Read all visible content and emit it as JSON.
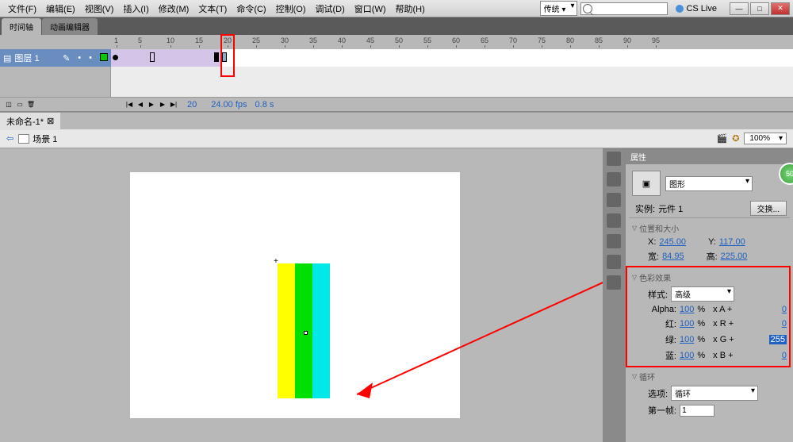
{
  "menu": {
    "file": "文件(F)",
    "edit": "编辑(E)",
    "view": "视图(V)",
    "insert": "插入(I)",
    "modify": "修改(M)",
    "text": "文本(T)",
    "commands": "命令(C)",
    "control": "控制(O)",
    "debug": "调试(D)",
    "window": "窗口(W)",
    "help": "帮助(H)"
  },
  "top_right": {
    "workspace": "传统 ▾",
    "cslive": "CS Live"
  },
  "tabs": {
    "timeline": "时间轴",
    "motion": "动画编辑器"
  },
  "ruler": {
    "ticks": [
      "1",
      "5",
      "10",
      "15",
      "20",
      "25",
      "30",
      "35",
      "40",
      "45",
      "50",
      "55",
      "60",
      "65",
      "70",
      "75",
      "80",
      "85",
      "90",
      "95"
    ]
  },
  "layer": {
    "name": "图层 1"
  },
  "tl_footer": {
    "frame": "20",
    "fps": "24.00 fps",
    "time": "0.8 s"
  },
  "doc": {
    "name": "未命名-1*"
  },
  "scene": {
    "name": "场景 1",
    "zoom": "100%"
  },
  "props": {
    "title": "属性",
    "type": "图形",
    "instance_lbl": "实例:",
    "instance": "元件 1",
    "swap": "交换...",
    "pos_hdr": "位置和大小",
    "x_lbl": "X:",
    "x": "245.00",
    "y_lbl": "Y:",
    "y": "117.00",
    "w_lbl": "宽:",
    "w": "84.95",
    "h_lbl": "高:",
    "h": "225.00",
    "color_hdr": "色彩效果",
    "style_lbl": "样式:",
    "style": "高级",
    "alpha_lbl": "Alpha:",
    "alpha_pct": "100",
    "alpha_mul": "x A  +",
    "alpha_off": "0",
    "r_lbl": "红:",
    "r_pct": "100",
    "r_mul": "x R  +",
    "r_off": "0",
    "g_lbl": "绿:",
    "g_pct": "100",
    "g_mul": "x G  +",
    "g_off": "255",
    "b_lbl": "蓝:",
    "b_pct": "100",
    "b_mul": "x B  +",
    "b_off": "0",
    "loop_hdr": "循环",
    "opt_lbl": "选项:",
    "opt": "循环",
    "first_lbl": "第一帧:",
    "first": "1"
  },
  "badge": "50"
}
